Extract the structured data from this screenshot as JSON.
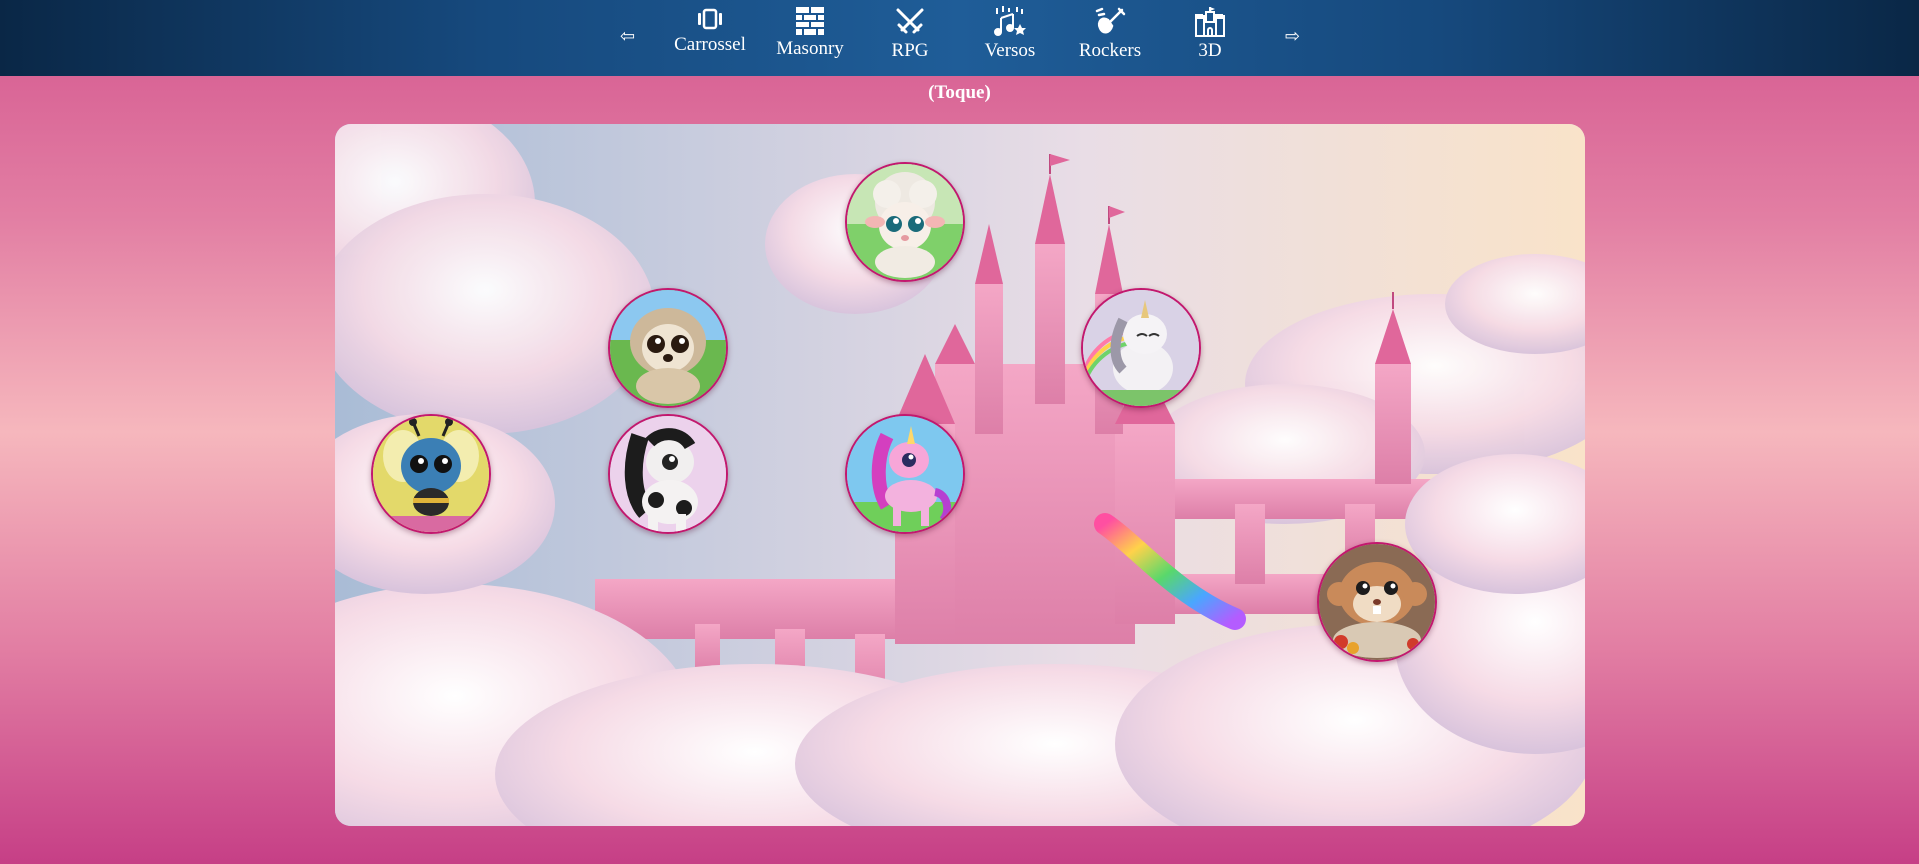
{
  "nav": {
    "prev_arrow": "⇦",
    "next_arrow": "⇨",
    "items": [
      {
        "label": "Carrossel",
        "icon": "carousel-icon"
      },
      {
        "label": "Masonry",
        "icon": "masonry-bricks-icon"
      },
      {
        "label": "RPG",
        "icon": "crossed-swords-icon"
      },
      {
        "label": "Versos",
        "icon": "music-notes-icon"
      },
      {
        "label": "Rockers",
        "icon": "guitar-icon"
      },
      {
        "label": "3D",
        "icon": "castle-icon"
      }
    ]
  },
  "subtitle": "(Toque)",
  "scene": {
    "background": "pink-castle-in-clouds",
    "avatars": [
      {
        "name": "lamb"
      },
      {
        "name": "fluffy-puppy"
      },
      {
        "name": "unicorn-white"
      },
      {
        "name": "blue-bee"
      },
      {
        "name": "black-white-pony"
      },
      {
        "name": "pink-unicorn"
      },
      {
        "name": "hamster"
      }
    ]
  },
  "colors": {
    "nav_bg": "#1f5d98",
    "page_bg": "#e27ea3",
    "avatar_border": "#c2186e"
  }
}
